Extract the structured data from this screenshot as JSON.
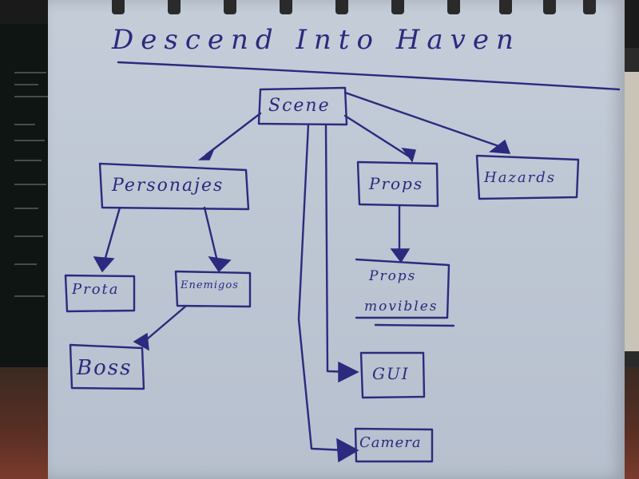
{
  "title": "Descend Into Haven",
  "nodes": {
    "scene": "Scene",
    "personajes": "Personajes",
    "props": "Props",
    "hazards": "Hazards",
    "prota": "Prota",
    "enemigos": "Enemigos",
    "boss": "Boss",
    "props_movibles_line1": "Props",
    "props_movibles_line2": "movibles",
    "gui": "GUI",
    "camera": "Camera"
  },
  "colors": {
    "ink": "#2b2a7e",
    "paper": "#c0c9d6"
  }
}
